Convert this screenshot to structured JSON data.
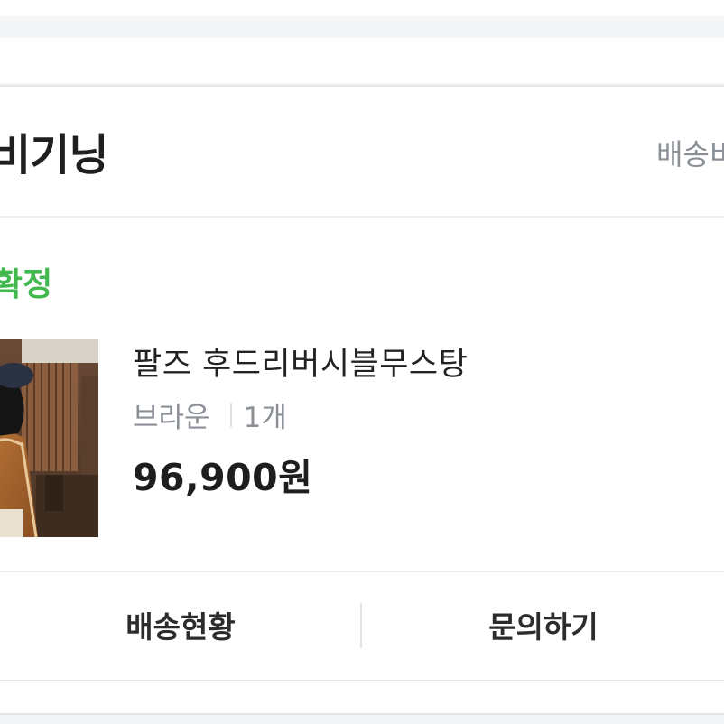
{
  "store": {
    "name": "비기닝",
    "shipping_label": "배송비"
  },
  "order": {
    "status": "확정"
  },
  "product": {
    "name": "팔즈 후드리버시블무스탕",
    "option_color": "브라운",
    "option_quantity": "1개",
    "price": "96,900원",
    "thumbnail_alt": "brown-mustang-coat-photo"
  },
  "actions": {
    "shipping_status_label": "배송현황",
    "inquiry_label": "문의하기"
  },
  "colors": {
    "status_green": "#42b84f",
    "background": "#f3f5f7"
  }
}
